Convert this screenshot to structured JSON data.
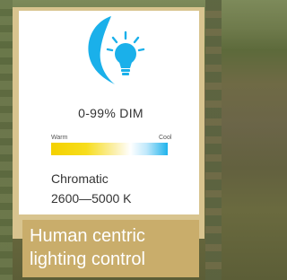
{
  "dim": {
    "label": "0-99% DIM",
    "icon": "dimmable-bulb-icon",
    "accent_color": "#1ab0ea"
  },
  "color_temperature": {
    "warm_label": "Warm",
    "cool_label": "Cool",
    "warm_color": "#f4d100",
    "cool_color": "#1fb3ec",
    "title": "Chromatic",
    "range": "2600—5000 K"
  },
  "caption": {
    "line1": "Human centric",
    "line2": "lighting control"
  }
}
